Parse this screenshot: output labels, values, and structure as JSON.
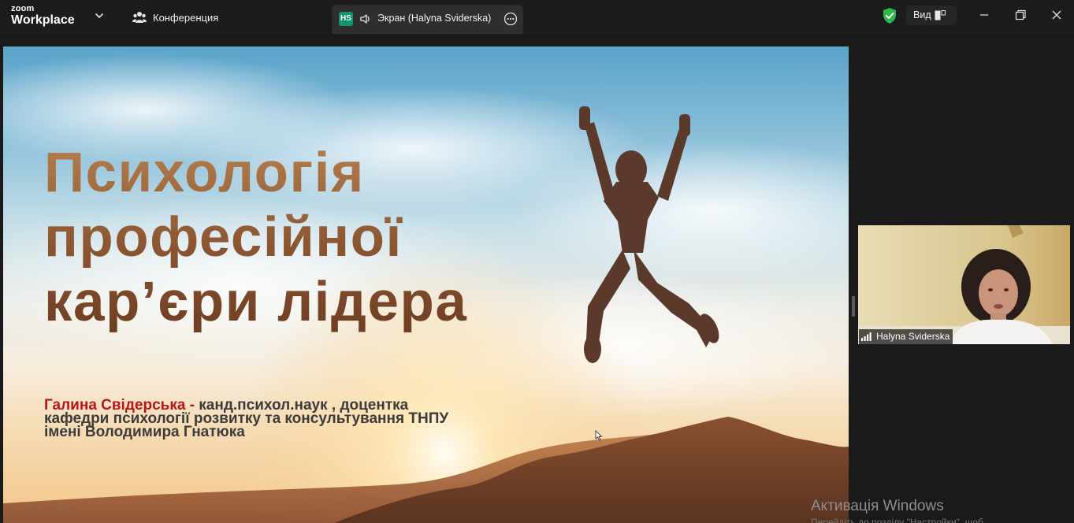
{
  "app": {
    "logo_small": "zoom",
    "logo_big": "Workplace"
  },
  "toolbar": {
    "conference_label": "Конференция"
  },
  "share_tab": {
    "initials": "HS",
    "label": "Экран (Halyna Sviderska)"
  },
  "view_button": {
    "label": "Вид"
  },
  "slide": {
    "title_lines": [
      "Психологія",
      "професійної",
      "кар’єри лідера"
    ],
    "author_name": "Галина Свідерська -",
    "author_line1_rest": " канд.психол.наук , доцентка",
    "author_line2": "кафедри психології розвитку та консультування  ТНПУ",
    "author_line3": "імені Володимира Гнатюка"
  },
  "participant": {
    "name": "Halyna Sviderska"
  },
  "watermark": {
    "title": "Активація Windows",
    "subtitle": "Перейдіть до розділу \"Настройки\", щоб"
  },
  "colors": {
    "accent_green": "#12956f",
    "shield_green": "#2db84b",
    "author_red": "#b3171b",
    "title_brown": "#8b5531"
  },
  "icons": {
    "chevron": "chevron-down-icon",
    "conference": "people-icon",
    "speaker": "speaker-icon",
    "more": "more-icon",
    "shield": "shield-check-icon",
    "view": "view-layout-icon",
    "minimize": "minimize-icon",
    "restore": "restore-icon",
    "close": "close-icon",
    "signal": "signal-icon"
  }
}
